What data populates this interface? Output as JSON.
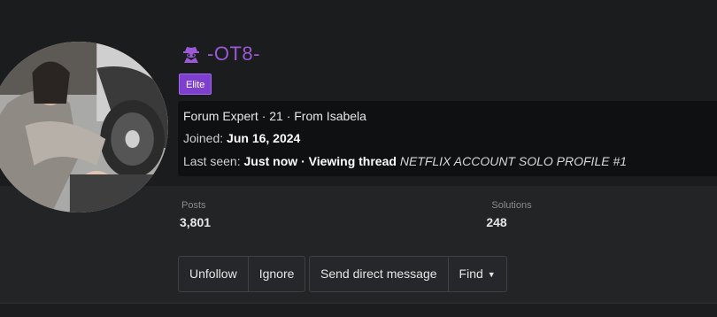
{
  "profile": {
    "username": "-OT8-",
    "badge": "Elite",
    "title_line": "Forum Expert · 21 · From Isabela",
    "joined_label": "Joined:",
    "joined_date": "Jun 16, 2024",
    "last_seen_label": "Last seen:",
    "last_seen_value": "Just now",
    "activity_label": "· Viewing thread",
    "thread_title": "NETFLIX ACCOUNT SOLO PROFILE #1",
    "colors": {
      "username": "#9b59d6",
      "badge": "#7e3fcf"
    },
    "icon": "spy-icon"
  },
  "stats": {
    "posts_label": "Posts",
    "posts_value": "3,801",
    "solutions_label": "Solutions",
    "solutions_value": "248"
  },
  "actions": {
    "unfollow": "Unfollow",
    "ignore": "Ignore",
    "send_message": "Send direct message",
    "find": "Find"
  }
}
